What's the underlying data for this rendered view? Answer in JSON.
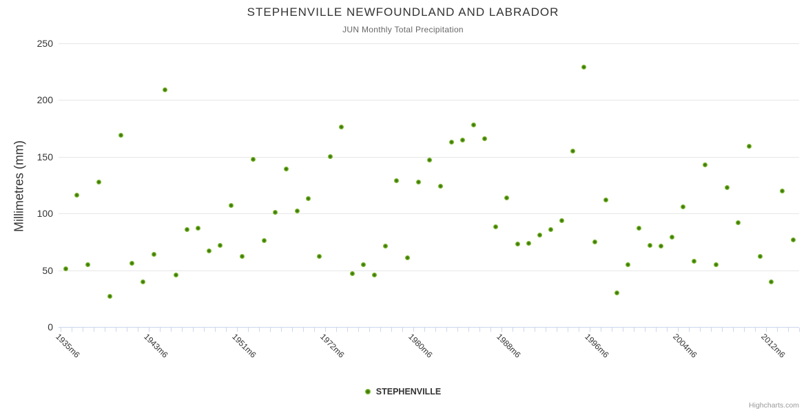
{
  "title": "STEPHENVILLE NEWFOUNDLAND AND LABRADOR",
  "subtitle": "JUN Monthly Total Precipitation",
  "y_axis": {
    "title": "Millimetres (mm)",
    "ticks": [
      0,
      50,
      100,
      150,
      200,
      250
    ]
  },
  "x_axis": {
    "tick_labels": [
      "1935m6",
      "1943m6",
      "1951m6",
      "1972m6",
      "1980m6",
      "1988m6",
      "1996m6",
      "2004m6",
      "2012m6"
    ],
    "tick_positions": [
      0,
      8,
      16,
      24,
      32,
      40,
      48,
      56,
      64
    ]
  },
  "legend": {
    "label": "STEPHENVILLE"
  },
  "credits": "Highcharts.com",
  "colors": {
    "marker_rim": "#7ab62a",
    "marker_core": "#3e7a10",
    "grid": "#e6e6e6",
    "axis_line": "#ccd6eb",
    "tick": "#ccd6eb",
    "title_color": "#333333",
    "subtitle_color": "#666666",
    "axis_label_color": "#333333",
    "credits_color": "#999999"
  },
  "chart_data": {
    "type": "scatter",
    "title": "STEPHENVILLE NEWFOUNDLAND AND LABRADOR",
    "subtitle": "JUN Monthly Total Precipitation",
    "ylabel": "Millimetres (mm)",
    "xlabel": "",
    "ylim": [
      0,
      250
    ],
    "grid": true,
    "legend_position": "bottom",
    "x_tick_labels": [
      "1935m6",
      "1943m6",
      "1951m6",
      "1972m6",
      "1980m6",
      "1988m6",
      "1996m6",
      "2004m6",
      "2012m6"
    ],
    "x_tick_indices": [
      0,
      8,
      16,
      24,
      32,
      40,
      48,
      56,
      64
    ],
    "series": [
      {
        "name": "STEPHENVILLE",
        "values": [
          51,
          116,
          55,
          128,
          27,
          169,
          56,
          40,
          64,
          209,
          46,
          86,
          87,
          67,
          72,
          107,
          62,
          148,
          76,
          101,
          139,
          102,
          113,
          62,
          150,
          176,
          47,
          55,
          46,
          71,
          129,
          61,
          128,
          147,
          124,
          163,
          165,
          178,
          166,
          88,
          114,
          73,
          74,
          81,
          86,
          94,
          155,
          229,
          75,
          112,
          30,
          55,
          87,
          72,
          71,
          79,
          106,
          58,
          143,
          55,
          123,
          92,
          159,
          62,
          40,
          120,
          77
        ]
      }
    ]
  }
}
